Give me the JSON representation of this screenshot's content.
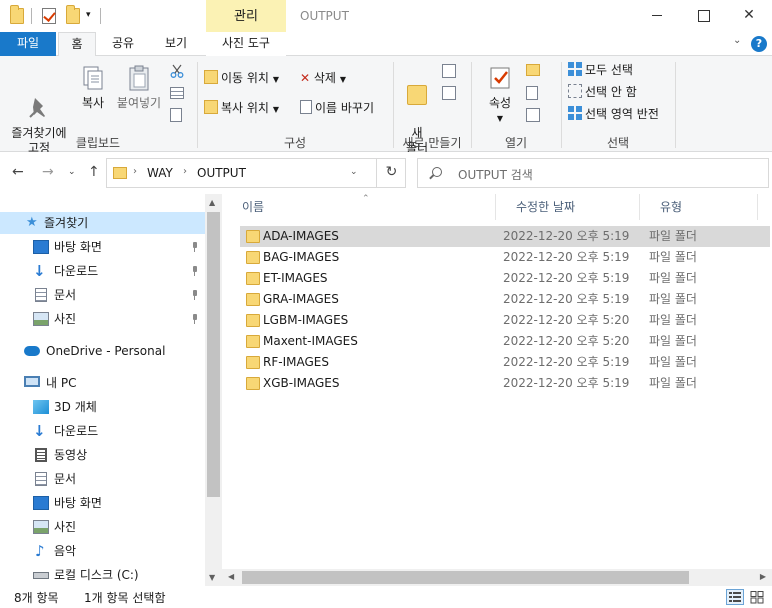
{
  "window": {
    "title": "OUTPUT",
    "contextual_tab_group": "관리",
    "controls": [
      "minimize",
      "maximize",
      "close"
    ]
  },
  "ribbon_tabs": [
    {
      "label": "파일"
    },
    {
      "label": "홈"
    },
    {
      "label": "공유"
    },
    {
      "label": "보기"
    },
    {
      "label": "사진 도구"
    }
  ],
  "ribbon": {
    "clipboard": {
      "group_label": "클립보드",
      "pin_label": "즐겨찾기에\n고정",
      "copy_label": "복사",
      "paste_label": "붙여넣기"
    },
    "organize": {
      "group_label": "구성",
      "move_to": "이동 위치",
      "copy_to": "복사 위치",
      "delete": "삭제",
      "rename": "이름 바꾸기"
    },
    "new": {
      "group_label": "새로 만들기",
      "new_folder": "새\n폴더"
    },
    "open": {
      "group_label": "열기",
      "properties": "속성"
    },
    "select": {
      "group_label": "선택",
      "select_all": "모두 선택",
      "select_none": "선택 안 함",
      "invert": "선택 영역 반전"
    }
  },
  "address": {
    "segments": [
      "WAY",
      "OUTPUT"
    ],
    "search_placeholder": "OUTPUT 검색"
  },
  "nav_pane": {
    "items": [
      {
        "label": "즐겨찾기",
        "icon": "star-icon",
        "selected": true
      },
      {
        "label": "바탕 화면",
        "icon": "desktop-icon",
        "pinned": true
      },
      {
        "label": "다운로드",
        "icon": "download-icon",
        "pinned": true
      },
      {
        "label": "문서",
        "icon": "document-icon",
        "pinned": true
      },
      {
        "label": "사진",
        "icon": "pictures-icon",
        "pinned": true
      },
      {
        "label": "OneDrive - Personal",
        "icon": "cloud-icon"
      },
      {
        "label": "내 PC",
        "icon": "pc-icon"
      },
      {
        "label": "3D 개체",
        "icon": "cube-icon"
      },
      {
        "label": "다운로드",
        "icon": "download-icon"
      },
      {
        "label": "동영상",
        "icon": "video-icon"
      },
      {
        "label": "문서",
        "icon": "document-icon"
      },
      {
        "label": "바탕 화면",
        "icon": "desktop-icon"
      },
      {
        "label": "사진",
        "icon": "pictures-icon"
      },
      {
        "label": "음악",
        "icon": "music-icon"
      },
      {
        "label": "로컬 디스크 (C:)",
        "icon": "drive-icon"
      }
    ]
  },
  "columns": {
    "name": "이름",
    "date": "수정한 날짜",
    "type": "유형"
  },
  "files": [
    {
      "name": "ADA-IMAGES",
      "date": "2022-12-20 오후 5:19",
      "type": "파일 폴더",
      "selected": true
    },
    {
      "name": "BAG-IMAGES",
      "date": "2022-12-20 오후 5:19",
      "type": "파일 폴더"
    },
    {
      "name": "ET-IMAGES",
      "date": "2022-12-20 오후 5:19",
      "type": "파일 폴더"
    },
    {
      "name": "GRA-IMAGES",
      "date": "2022-12-20 오후 5:19",
      "type": "파일 폴더"
    },
    {
      "name": "LGBM-IMAGES",
      "date": "2022-12-20 오후 5:20",
      "type": "파일 폴더"
    },
    {
      "name": "Maxent-IMAGES",
      "date": "2022-12-20 오후 5:20",
      "type": "파일 폴더"
    },
    {
      "name": "RF-IMAGES",
      "date": "2022-12-20 오후 5:19",
      "type": "파일 폴더"
    },
    {
      "name": "XGB-IMAGES",
      "date": "2022-12-20 오후 5:19",
      "type": "파일 폴더"
    }
  ],
  "status": {
    "item_count": "8개 항목",
    "selection": "1개 항목 선택함"
  },
  "colors": {
    "accent": "#1979ca",
    "selection": "#cce8ff",
    "manage_tab": "#fbf2b4",
    "folder": "#f8d775"
  }
}
